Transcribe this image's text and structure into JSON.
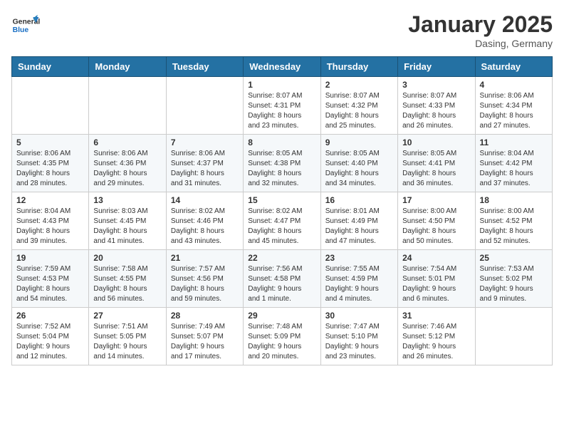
{
  "header": {
    "logo_general": "General",
    "logo_blue": "Blue",
    "month": "January 2025",
    "location": "Dasing, Germany"
  },
  "weekdays": [
    "Sunday",
    "Monday",
    "Tuesday",
    "Wednesday",
    "Thursday",
    "Friday",
    "Saturday"
  ],
  "weeks": [
    [
      {
        "day": "",
        "info": ""
      },
      {
        "day": "",
        "info": ""
      },
      {
        "day": "",
        "info": ""
      },
      {
        "day": "1",
        "info": "Sunrise: 8:07 AM\nSunset: 4:31 PM\nDaylight: 8 hours\nand 23 minutes."
      },
      {
        "day": "2",
        "info": "Sunrise: 8:07 AM\nSunset: 4:32 PM\nDaylight: 8 hours\nand 25 minutes."
      },
      {
        "day": "3",
        "info": "Sunrise: 8:07 AM\nSunset: 4:33 PM\nDaylight: 8 hours\nand 26 minutes."
      },
      {
        "day": "4",
        "info": "Sunrise: 8:06 AM\nSunset: 4:34 PM\nDaylight: 8 hours\nand 27 minutes."
      }
    ],
    [
      {
        "day": "5",
        "info": "Sunrise: 8:06 AM\nSunset: 4:35 PM\nDaylight: 8 hours\nand 28 minutes."
      },
      {
        "day": "6",
        "info": "Sunrise: 8:06 AM\nSunset: 4:36 PM\nDaylight: 8 hours\nand 29 minutes."
      },
      {
        "day": "7",
        "info": "Sunrise: 8:06 AM\nSunset: 4:37 PM\nDaylight: 8 hours\nand 31 minutes."
      },
      {
        "day": "8",
        "info": "Sunrise: 8:05 AM\nSunset: 4:38 PM\nDaylight: 8 hours\nand 32 minutes."
      },
      {
        "day": "9",
        "info": "Sunrise: 8:05 AM\nSunset: 4:40 PM\nDaylight: 8 hours\nand 34 minutes."
      },
      {
        "day": "10",
        "info": "Sunrise: 8:05 AM\nSunset: 4:41 PM\nDaylight: 8 hours\nand 36 minutes."
      },
      {
        "day": "11",
        "info": "Sunrise: 8:04 AM\nSunset: 4:42 PM\nDaylight: 8 hours\nand 37 minutes."
      }
    ],
    [
      {
        "day": "12",
        "info": "Sunrise: 8:04 AM\nSunset: 4:43 PM\nDaylight: 8 hours\nand 39 minutes."
      },
      {
        "day": "13",
        "info": "Sunrise: 8:03 AM\nSunset: 4:45 PM\nDaylight: 8 hours\nand 41 minutes."
      },
      {
        "day": "14",
        "info": "Sunrise: 8:02 AM\nSunset: 4:46 PM\nDaylight: 8 hours\nand 43 minutes."
      },
      {
        "day": "15",
        "info": "Sunrise: 8:02 AM\nSunset: 4:47 PM\nDaylight: 8 hours\nand 45 minutes."
      },
      {
        "day": "16",
        "info": "Sunrise: 8:01 AM\nSunset: 4:49 PM\nDaylight: 8 hours\nand 47 minutes."
      },
      {
        "day": "17",
        "info": "Sunrise: 8:00 AM\nSunset: 4:50 PM\nDaylight: 8 hours\nand 50 minutes."
      },
      {
        "day": "18",
        "info": "Sunrise: 8:00 AM\nSunset: 4:52 PM\nDaylight: 8 hours\nand 52 minutes."
      }
    ],
    [
      {
        "day": "19",
        "info": "Sunrise: 7:59 AM\nSunset: 4:53 PM\nDaylight: 8 hours\nand 54 minutes."
      },
      {
        "day": "20",
        "info": "Sunrise: 7:58 AM\nSunset: 4:55 PM\nDaylight: 8 hours\nand 56 minutes."
      },
      {
        "day": "21",
        "info": "Sunrise: 7:57 AM\nSunset: 4:56 PM\nDaylight: 8 hours\nand 59 minutes."
      },
      {
        "day": "22",
        "info": "Sunrise: 7:56 AM\nSunset: 4:58 PM\nDaylight: 9 hours\nand 1 minute."
      },
      {
        "day": "23",
        "info": "Sunrise: 7:55 AM\nSunset: 4:59 PM\nDaylight: 9 hours\nand 4 minutes."
      },
      {
        "day": "24",
        "info": "Sunrise: 7:54 AM\nSunset: 5:01 PM\nDaylight: 9 hours\nand 6 minutes."
      },
      {
        "day": "25",
        "info": "Sunrise: 7:53 AM\nSunset: 5:02 PM\nDaylight: 9 hours\nand 9 minutes."
      }
    ],
    [
      {
        "day": "26",
        "info": "Sunrise: 7:52 AM\nSunset: 5:04 PM\nDaylight: 9 hours\nand 12 minutes."
      },
      {
        "day": "27",
        "info": "Sunrise: 7:51 AM\nSunset: 5:05 PM\nDaylight: 9 hours\nand 14 minutes."
      },
      {
        "day": "28",
        "info": "Sunrise: 7:49 AM\nSunset: 5:07 PM\nDaylight: 9 hours\nand 17 minutes."
      },
      {
        "day": "29",
        "info": "Sunrise: 7:48 AM\nSunset: 5:09 PM\nDaylight: 9 hours\nand 20 minutes."
      },
      {
        "day": "30",
        "info": "Sunrise: 7:47 AM\nSunset: 5:10 PM\nDaylight: 9 hours\nand 23 minutes."
      },
      {
        "day": "31",
        "info": "Sunrise: 7:46 AM\nSunset: 5:12 PM\nDaylight: 9 hours\nand 26 minutes."
      },
      {
        "day": "",
        "info": ""
      }
    ]
  ]
}
